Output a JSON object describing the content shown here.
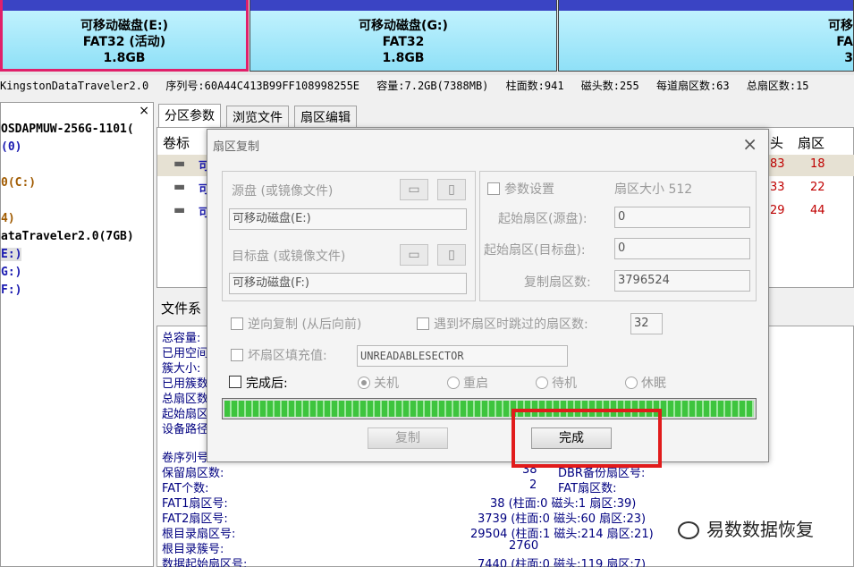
{
  "partitions": [
    {
      "name": "可移动磁盘(E:)",
      "fs": "FAT32 (活动)",
      "size": "1.8GB"
    },
    {
      "name": "可移动磁盘(G:)",
      "fs": "FAT32",
      "size": "1.8GB"
    },
    {
      "name": "可移",
      "fs": "FA",
      "size": "3"
    }
  ],
  "disk_info": {
    "model": "KingstonDataTraveler2.0",
    "serial": "序列号:60A44C413B99FF108998255E",
    "capacity": "容量:7.2GB(7388MB)",
    "cylinders": "柱面数:941",
    "heads": "磁头数:255",
    "sectors_per_track": "每道扇区数:63",
    "total_sectors": "总扇区数:15"
  },
  "tree": {
    "close": "×",
    "items": [
      "OSDAPMUW-256G-1101(",
      "(0)",
      "0(C:)",
      "4)",
      "ataTraveler2.0(7GB)",
      "E:)",
      "G:)",
      "F:)"
    ]
  },
  "tabs": [
    "分区参数",
    "浏览文件",
    "扇区编辑"
  ],
  "table": {
    "col_label": "卷标",
    "col_head": "头",
    "col_sector": "扇区",
    "rows": [
      {
        "name": "可",
        "head": "83",
        "sector": "18"
      },
      {
        "name": "可",
        "head": "33",
        "sector": "22"
      },
      {
        "name": "可",
        "head": "29",
        "sector": "44"
      }
    ]
  },
  "fs_label": "文件系",
  "details_left": [
    "总容量:",
    "已用空间",
    "簇大小:",
    "已用簇数",
    "总扇区数",
    "起始扇区",
    "设备路径"
  ],
  "details_lower": [
    {
      "k": "卷序列号",
      "v": "",
      "v2": ""
    },
    {
      "k": "保留扇区数:",
      "v": "38",
      "v2": "DBR备份扇区号:"
    },
    {
      "k": "FAT个数:",
      "v": "2",
      "v2": "FAT扇区数:"
    },
    {
      "k": "FAT1扇区号:",
      "v": "38 (柱面:0 磁头:1 扇区:39)",
      "v2": ""
    },
    {
      "k": "FAT2扇区号:",
      "v": "3739 (柱面:0 磁头:60 扇区:23)",
      "v2": ""
    },
    {
      "k": "根目录扇区号:",
      "v": "29504 (柱面:1 磁头:214 扇区:21)",
      "v2": ""
    },
    {
      "k": "根目录簇号:",
      "v": "2760",
      "v2": ""
    },
    {
      "k": "数据起始扇区号:",
      "v": "7440 (柱面:0 磁头:119 扇区:7)",
      "v2": ""
    }
  ],
  "dialog": {
    "title": "扇区复制",
    "close": "×",
    "source_label": "源盘 (或镜像文件)",
    "source_value": "可移动磁盘(E:)",
    "target_label": "目标盘 (或镜像文件)",
    "target_value": "可移动磁盘(F:)",
    "params_label": "参数设置",
    "sector_size": "扇区大小 512",
    "start_src_label": "起始扇区(源盘):",
    "start_src_value": "0",
    "start_dst_label": "起始扇区(目标盘):",
    "start_dst_value": "0",
    "count_label": "复制扇区数:",
    "count_value": "3796524",
    "reverse_label": "逆向复制 (从后向前)",
    "skip_label": "遇到坏扇区时跳过的扇区数:",
    "skip_value": "32",
    "fill_label": "坏扇区填充值:",
    "fill_value": "UNREADABLESECTOR",
    "after_label": "完成后:",
    "after_options": [
      "关机",
      "重启",
      "待机",
      "休眠"
    ],
    "after_selected": 0,
    "progress": 1.0,
    "copy_button": "复制",
    "done_button": "完成"
  },
  "watermark": "易数数据恢复",
  "colors": {
    "partition_header": "#3a44c4",
    "partition_body": "#8fe0f7",
    "selected_border": "#e0206a",
    "progress": "#3ec43e",
    "highlight": "#e11b1b",
    "detail_text": "#000080"
  }
}
